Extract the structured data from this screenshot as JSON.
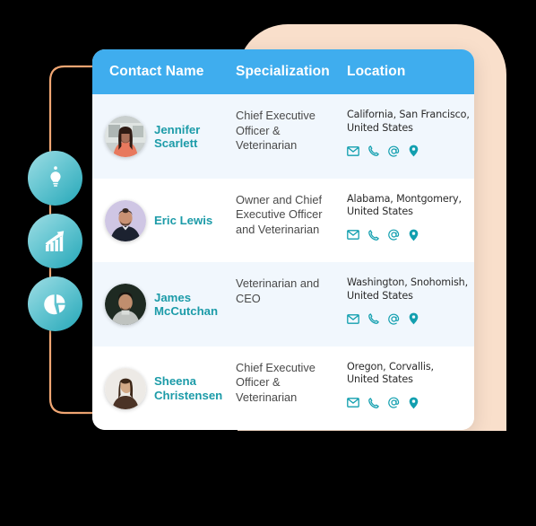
{
  "colors": {
    "header_blue": "#3FADEE",
    "name_teal": "#1C9BA8",
    "icon_teal": "#129FAF",
    "row_alt": "#F1F7FD",
    "peach": "#F9DFCB",
    "bracket_orange": "#F0A673"
  },
  "table": {
    "columns": [
      {
        "key": "name",
        "label": "Contact Name"
      },
      {
        "key": "spec",
        "label": "Specialization"
      },
      {
        "key": "loc",
        "label": "Location"
      }
    ],
    "rows": [
      {
        "name": "Jennifer Scarlett",
        "name_line1": "Jennifer",
        "name_line2": "Scarlett",
        "specialization": "Chief Executive Officer & Veterinarian",
        "location_line1": "California, San Francisco,",
        "location_line2": "United States",
        "contact_icons": [
          "email-icon",
          "phone-icon",
          "at-icon",
          "map-pin-icon"
        ]
      },
      {
        "name": "Eric Lewis",
        "name_line1": "Eric Lewis",
        "name_line2": "",
        "specialization": "Owner and Chief Executive Officer and Veterinarian",
        "location_line1": "Alabama, Montgomery,",
        "location_line2": "United States",
        "contact_icons": [
          "email-icon",
          "phone-icon",
          "at-icon",
          "map-pin-icon"
        ]
      },
      {
        "name": "James McCutchan",
        "name_line1": "James",
        "name_line2": "McCutchan",
        "specialization": "Veterinarian and CEO",
        "location_line1": "Washington, Snohomish,",
        "location_line2": "United States",
        "contact_icons": [
          "email-icon",
          "phone-icon",
          "at-icon",
          "map-pin-icon"
        ]
      },
      {
        "name": "Sheena Christensen",
        "name_line1": "Sheena",
        "name_line2": "Christensen",
        "specialization": "Chief Executive Officer & Veterinarian",
        "location_line1": "Oregon, Corvallis,",
        "location_line2": "United States",
        "contact_icons": [
          "email-icon",
          "phone-icon",
          "at-icon",
          "map-pin-icon"
        ]
      }
    ]
  },
  "side_badges": [
    {
      "icon": "lightbulb-icon"
    },
    {
      "icon": "bar-chart-growth-icon"
    },
    {
      "icon": "pie-chart-icon"
    }
  ]
}
